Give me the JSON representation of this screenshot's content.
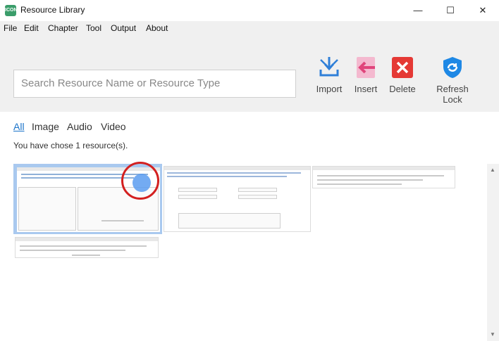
{
  "window": {
    "app_icon_text": "ICON",
    "title": "Resource Library",
    "minimize": "—",
    "maximize": "☐",
    "close": "✕"
  },
  "menu": [
    "File",
    "Edit",
    "Chapter",
    "Tool",
    "Output",
    "About"
  ],
  "search": {
    "placeholder": "Search Resource Name or Resource Type"
  },
  "toolbar": {
    "import": "Import",
    "insert": "Insert",
    "delete": "Delete",
    "refresh_lock": "Refresh Lock",
    "colors": {
      "import": "#2f7fd8",
      "insert": "#e0457b",
      "delete": "#e53935",
      "refresh": "#1e88e5"
    }
  },
  "filters": {
    "all": "All",
    "image": "Image",
    "audio": "Audio",
    "video": "Video"
  },
  "status_text": "You have chose 1 resource(s).",
  "thumbnails": [
    {
      "name": "thumb-1",
      "selected": true
    },
    {
      "name": "thumb-2",
      "selected": false
    },
    {
      "name": "thumb-3",
      "selected": false
    },
    {
      "name": "thumb-4",
      "selected": false
    }
  ],
  "scrollbar": {
    "up": "▲",
    "down": "▼"
  }
}
